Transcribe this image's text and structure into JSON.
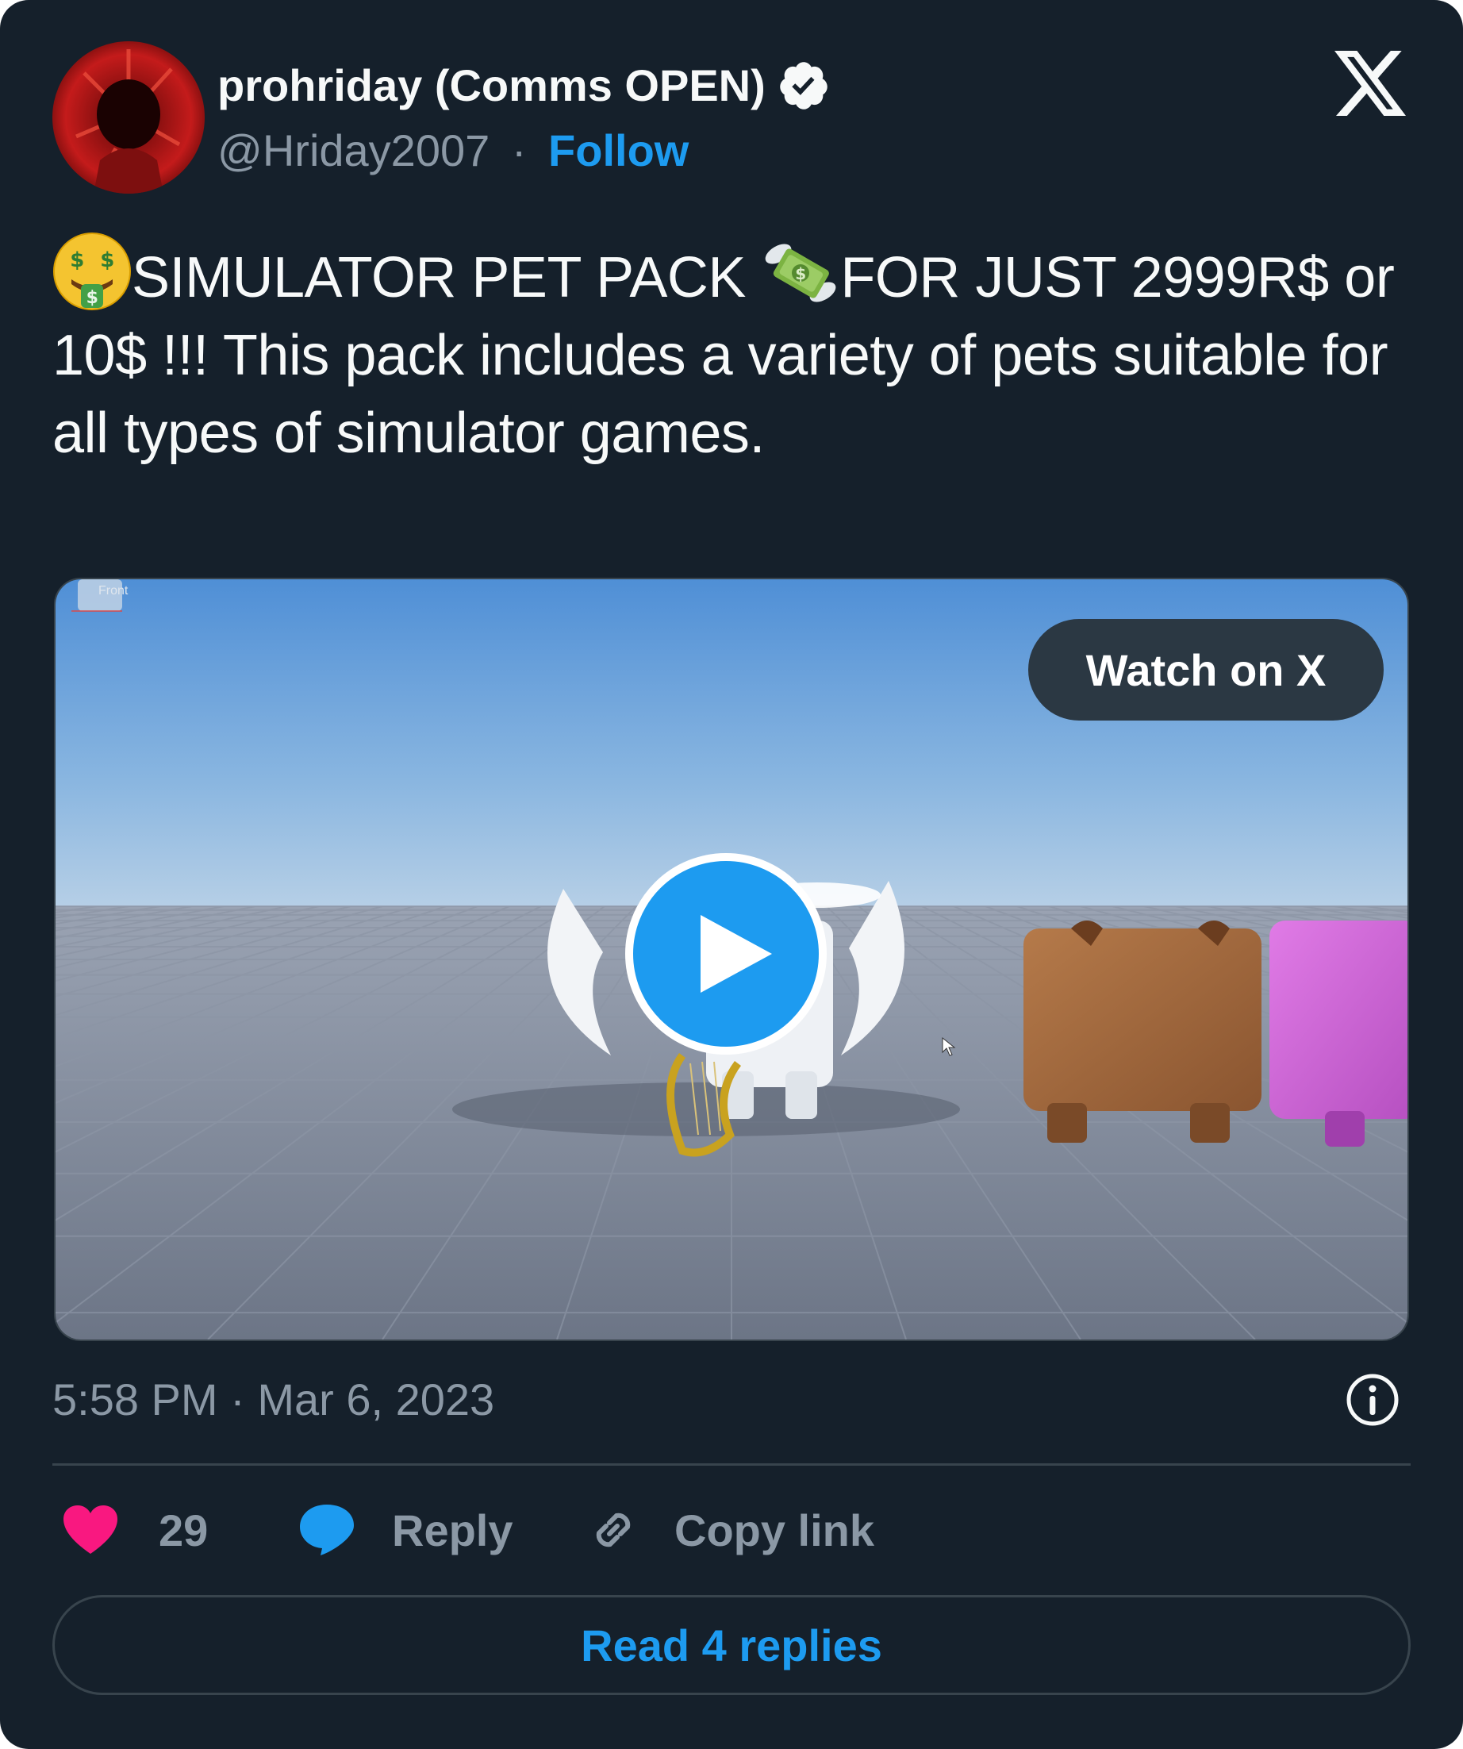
{
  "author": {
    "name": "prohriday (Comms OPEN)",
    "handle": "@Hriday2007",
    "separator": "·",
    "follow_label": "Follow",
    "verified": true
  },
  "tweet": {
    "emoji_1": "money-mouth-face",
    "segment_1": "SIMULATOR PET PACK ",
    "emoji_2": "money-with-wings",
    "segment_2": "FOR JUST 2999R$ or 10$ !!! This pack includes a variety of pets suitable for all types of simulator games."
  },
  "media": {
    "type": "video",
    "watch_label": "Watch on X",
    "viewport_label": "Front"
  },
  "meta": {
    "timestamp": "5:58 PM · Mar 6, 2023"
  },
  "actions": {
    "likes_count": "29",
    "reply_label": "Reply",
    "copy_link_label": "Copy link"
  },
  "footer": {
    "read_replies_label": "Read 4 replies"
  },
  "colors": {
    "background": "#15202b",
    "accent": "#1d9bf0",
    "muted": "#8b98a5",
    "like": "#f91880",
    "border": "#38444d"
  }
}
